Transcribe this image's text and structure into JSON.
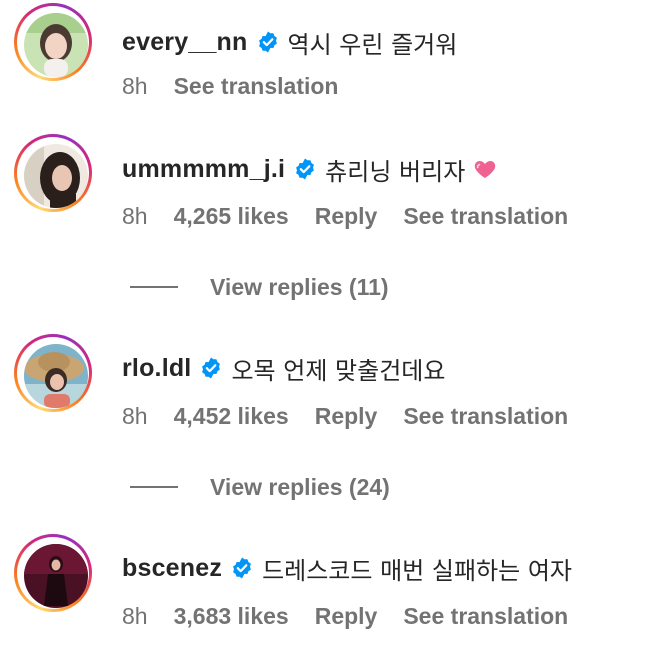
{
  "comments": [
    {
      "username": "every__nn",
      "text": "역시 우린 즐거워",
      "time": "8h",
      "likes": "",
      "reply_label": "",
      "translate_label": "See translation",
      "emoji": "",
      "replies_label": ""
    },
    {
      "username": "ummmmm_j.i",
      "text": "츄리닝 버리자",
      "time": "8h",
      "likes": "4,265 likes",
      "reply_label": "Reply",
      "translate_label": "See translation",
      "emoji": "heart",
      "replies_label": "View replies (11)"
    },
    {
      "username": "rlo.ldl",
      "text": "오목 언제 맞출건데요",
      "time": "8h",
      "likes": "4,452 likes",
      "reply_label": "Reply",
      "translate_label": "See translation",
      "emoji": "",
      "replies_label": "View replies (24)"
    },
    {
      "username": "bscenez",
      "text": "드레스코드 매번 실패하는 여자",
      "time": "8h",
      "likes": "3,683 likes",
      "reply_label": "Reply",
      "translate_label": "See translation",
      "emoji": "",
      "replies_label": ""
    }
  ],
  "colors": {
    "text": "#262626",
    "muted": "#737373",
    "verified": "#0095f6",
    "heart": "#f06292"
  },
  "icons": {
    "verified": "verified-badge-icon",
    "heart": "pink-heart-emoji"
  }
}
